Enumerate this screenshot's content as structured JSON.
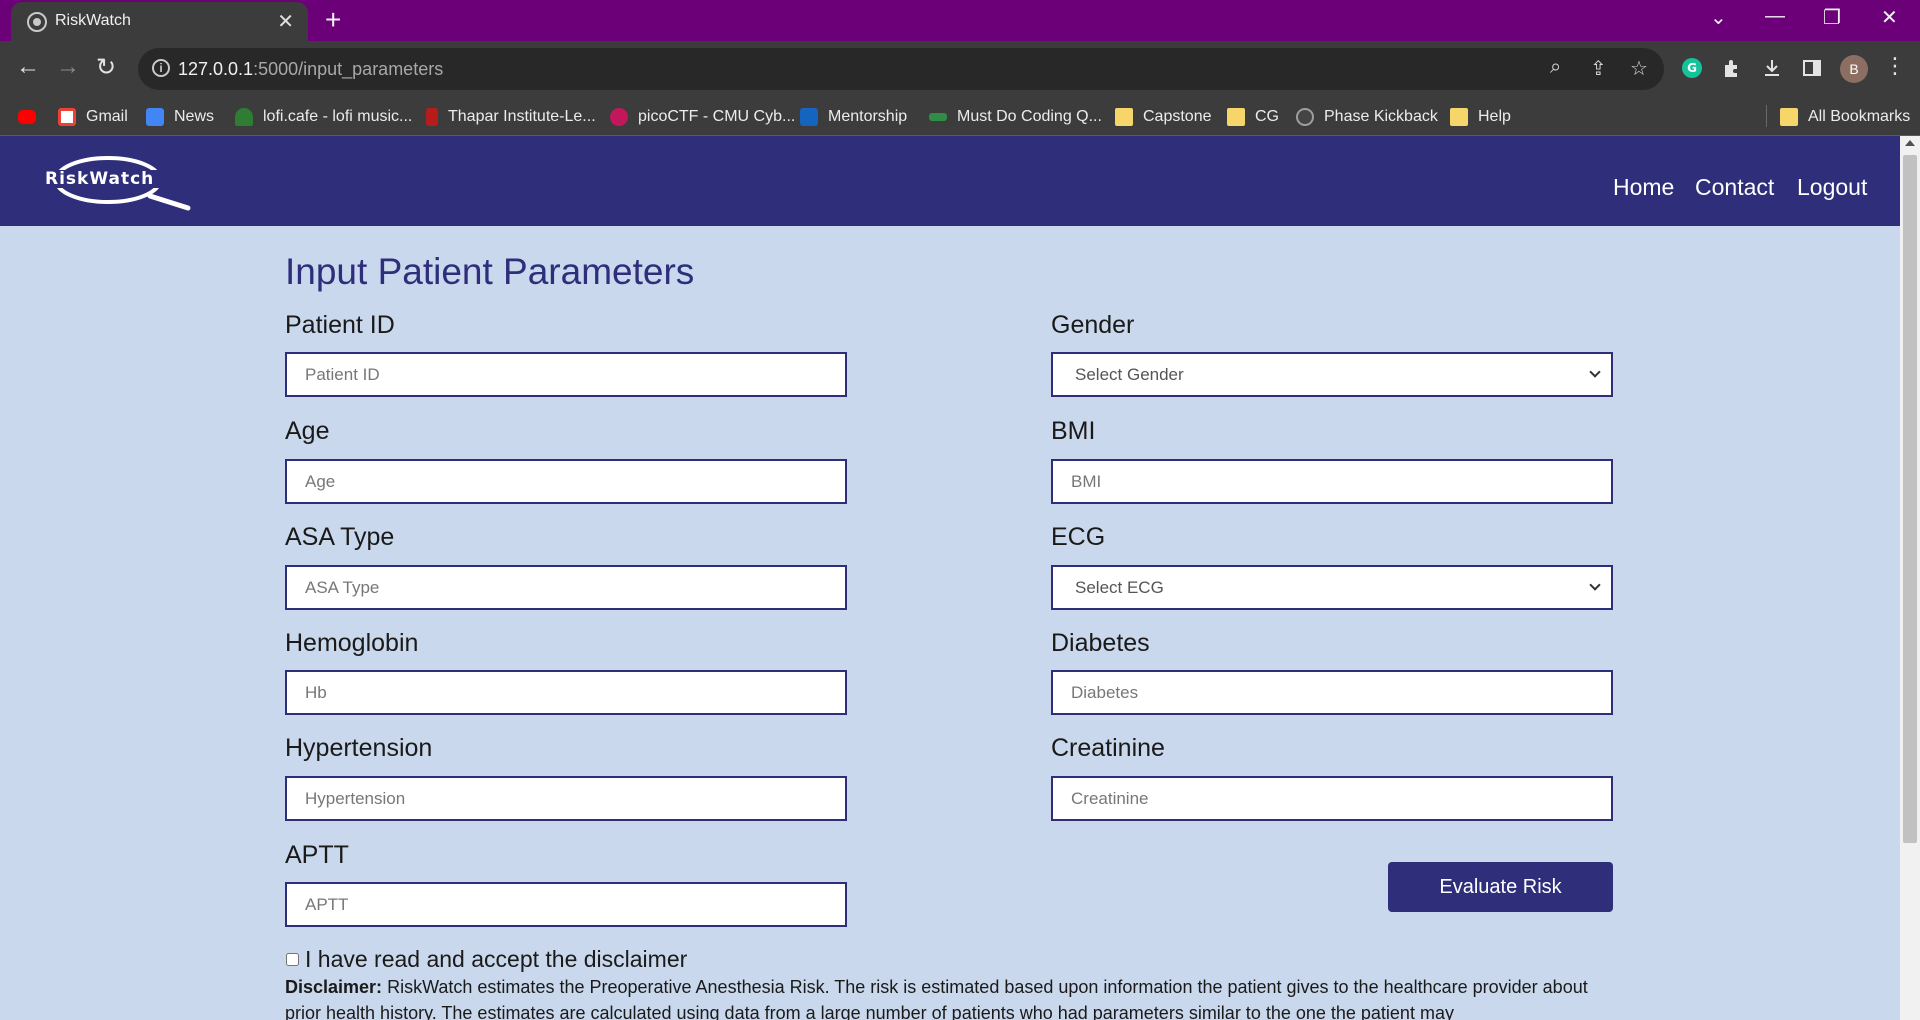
{
  "browser": {
    "tab_title": "RiskWatch",
    "url_host": "127.0.0.1",
    "url_path": ":5000/input_parameters",
    "profile_initial": "B",
    "bookmarks": [
      {
        "label": "",
        "icon": "youtube-icon",
        "color": "#ff0000"
      },
      {
        "label": "Gmail",
        "icon": "gmail-icon",
        "color": "#ea4335"
      },
      {
        "label": "News",
        "icon": "google-news-icon",
        "color": "#4285f4"
      },
      {
        "label": "lofi.cafe - lofi music...",
        "icon": "headphones-icon",
        "color": "#2e7d32"
      },
      {
        "label": "Thapar Institute-Le...",
        "icon": "thapar-icon",
        "color": "#b71c1c"
      },
      {
        "label": "picoCTF - CMU Cyb...",
        "icon": "picoctf-icon",
        "color": "#c2185b"
      },
      {
        "label": "Mentorship",
        "icon": "mentorship-icon",
        "color": "#1565c0"
      },
      {
        "label": "Must Do Coding Q...",
        "icon": "geeksforgeeks-icon",
        "color": "#2f8d46"
      },
      {
        "label": "Capstone",
        "icon": "folder-icon",
        "color": "#f6d56b"
      },
      {
        "label": "CG",
        "icon": "folder-icon",
        "color": "#f6d56b"
      },
      {
        "label": "Phase Kickback",
        "icon": "globe-icon",
        "color": "#9e9e9e"
      },
      {
        "label": "Help",
        "icon": "folder-icon",
        "color": "#f6d56b"
      }
    ],
    "all_bookmarks": "All Bookmarks"
  },
  "site": {
    "logo_text": "RiskWatch",
    "nav": [
      "Home",
      "Contact",
      "Logout"
    ]
  },
  "form": {
    "title": "Input Patient Parameters",
    "fields": {
      "patient_id": {
        "label": "Patient ID",
        "placeholder": "Patient ID"
      },
      "gender": {
        "label": "Gender",
        "selected": "Select Gender"
      },
      "age": {
        "label": "Age",
        "placeholder": "Age"
      },
      "bmi": {
        "label": "BMI",
        "placeholder": "BMI"
      },
      "asa_type": {
        "label": "ASA Type",
        "placeholder": "ASA Type"
      },
      "ecg": {
        "label": "ECG",
        "selected": "Select ECG"
      },
      "hemoglobin": {
        "label": "Hemoglobin",
        "placeholder": "Hb"
      },
      "diabetes": {
        "label": "Diabetes",
        "placeholder": "Diabetes"
      },
      "hypertension": {
        "label": "Hypertension",
        "placeholder": "Hypertension"
      },
      "creatinine": {
        "label": "Creatinine",
        "placeholder": "Creatinine"
      },
      "aptt": {
        "label": "APTT",
        "placeholder": "APTT"
      }
    },
    "submit_label": "Evaluate Risk",
    "disclaimer_checkbox": "I have read and accept the disclaimer",
    "disclaimer_heading": "Disclaimer:",
    "disclaimer_body": "RiskWatch estimates the Preoperative Anesthesia Risk. The risk is estimated based upon information the patient gives to the healthcare provider about prior health history. The estimates are calculated using data from a large number of patients who had parameters similar to the one the patient may"
  },
  "colors": {
    "brand": "#2e2e7b",
    "page_bg": "#c9d8ec",
    "tabbar": "#6b0078"
  }
}
